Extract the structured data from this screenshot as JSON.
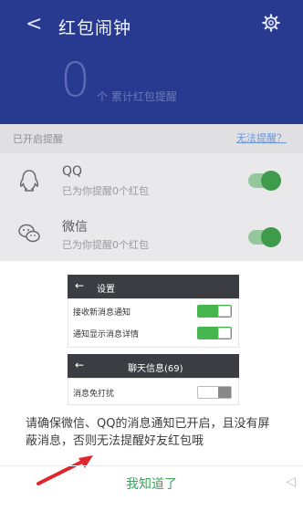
{
  "header": {
    "back_icon": "back-arrow-icon",
    "title": "红包闹钟",
    "settings_icon": "gear-icon"
  },
  "counter": {
    "value": "0",
    "label": "个 累计红包提醒"
  },
  "list": {
    "section_label": "已开启提醒",
    "help_link": "无法提醒？",
    "apps": [
      {
        "name": "QQ",
        "subtitle": "已为你提醒0个红包",
        "icon": "qq-icon",
        "enabled": true
      },
      {
        "name": "微信",
        "subtitle": "已为你提醒0个红包",
        "icon": "wechat-icon",
        "enabled": true
      }
    ]
  },
  "illustration": {
    "settings_bar": {
      "back": "←",
      "title": "设置"
    },
    "rows": [
      {
        "label": "接收新消息通知",
        "on": true
      },
      {
        "label": "通知显示消息详情",
        "on": true
      }
    ],
    "chat_bar": {
      "back": "←",
      "title": "聊天信息(69)"
    },
    "chat_rows": [
      {
        "label": "消息免打扰",
        "on": false
      }
    ]
  },
  "sheet": {
    "message": "请确保微信、QQ的消息通知已开启，且没有屏蔽消息，否则无法提醒好友红包哦",
    "confirm_button": "我知道了"
  },
  "colors": {
    "header_bg": "#283a8f",
    "accent_green": "#3aa55b",
    "toggle_on": "#46b64e"
  }
}
